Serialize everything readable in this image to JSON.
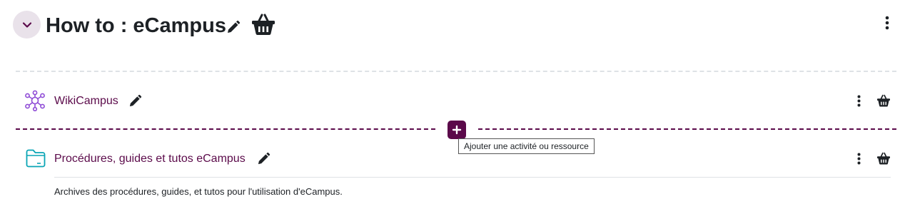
{
  "section": {
    "title": "How to : eCampus",
    "collapse_icon": "chevron-down-icon",
    "edit_icon": "pencil-icon",
    "basket_icon": "basket-icon",
    "menu_icon": "kebab-menu-icon"
  },
  "activities": [
    {
      "name": "WikiCampus",
      "type_icon": "wiki-icon",
      "icon_color": "#8f4cd6"
    },
    {
      "name": "Procédures, guides et tutos eCampus",
      "type_icon": "folder-icon",
      "icon_color": "#0aa5b5",
      "description": "Archives des procédures, guides, et tutos pour l'utilisation d'eCampus."
    }
  ],
  "add_activity": {
    "tooltip": "Ajouter une activité ou ressource",
    "accent_color": "#5b0a4a"
  }
}
